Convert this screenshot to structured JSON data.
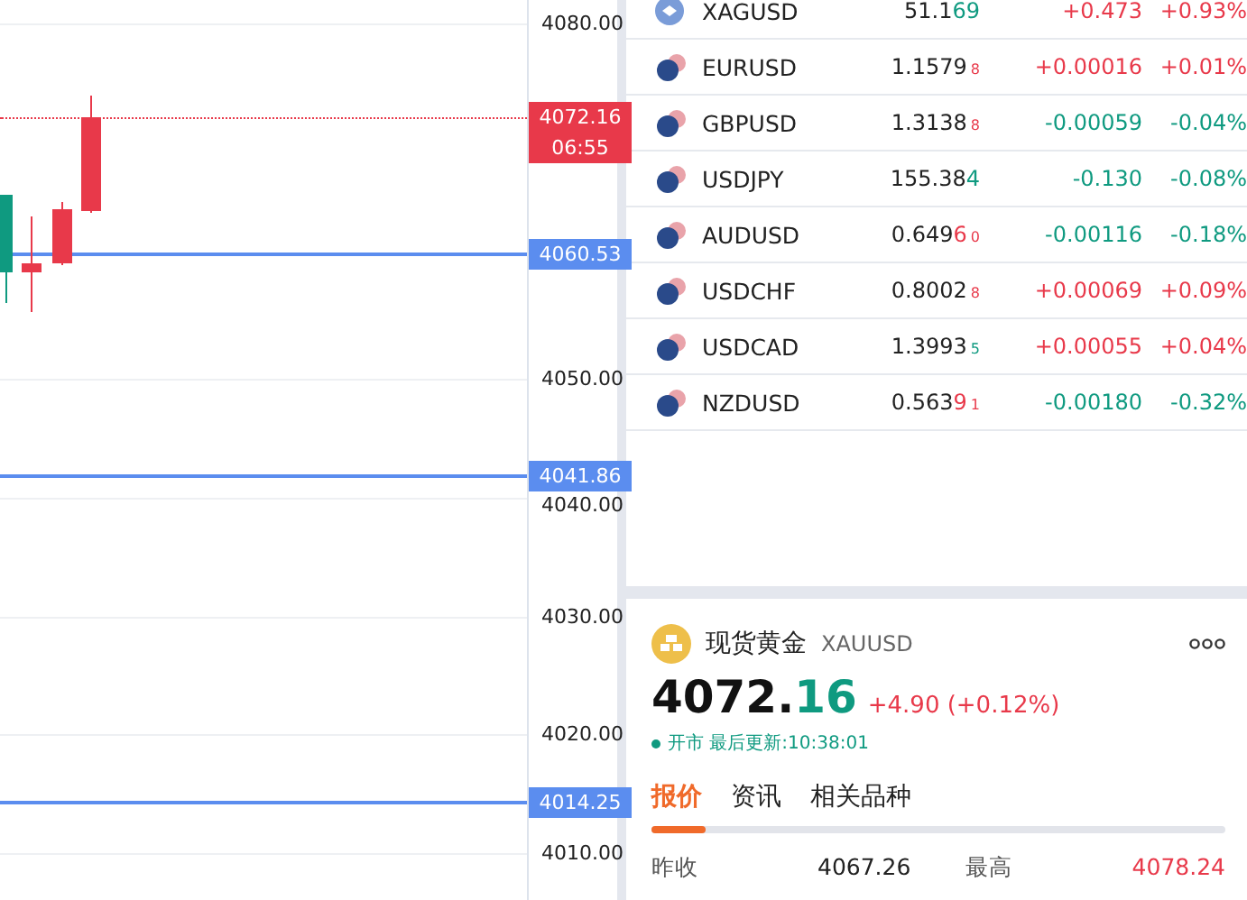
{
  "chart": {
    "axis_labels": [
      "4080.00",
      "4050.00",
      "4040.00",
      "4030.00",
      "4020.00",
      "4010.00"
    ],
    "price_lines": [
      "4060.53",
      "4041.86",
      "4014.25"
    ],
    "last_price": {
      "price": "4072.16",
      "countdown": "06:55"
    }
  },
  "watchlist": [
    {
      "kind": "metal",
      "symbol": "XAGUSD",
      "price_main": "51.1",
      "price_tick": "69",
      "price_up": false,
      "change": "+0.473",
      "percent": "+0.93%",
      "up": true
    },
    {
      "kind": "pair",
      "symbol": "EURUSD",
      "price_main": "1.1579",
      "price_pip": "8",
      "price_up": true,
      "change": "+0.00016",
      "percent": "+0.01%",
      "up": true
    },
    {
      "kind": "pair",
      "symbol": "GBPUSD",
      "price_main": "1.3138",
      "price_pip": "8",
      "price_up": true,
      "change": "-0.00059",
      "percent": "-0.04%",
      "up": false
    },
    {
      "kind": "pair",
      "symbol": "USDJPY",
      "price_main": "155.38",
      "price_tick": "4",
      "price_up": false,
      "change": "-0.130",
      "percent": "-0.08%",
      "up": false
    },
    {
      "kind": "pair",
      "symbol": "AUDUSD",
      "price_main": "0.649",
      "price_tick": "6",
      "price_pip": "0",
      "price_up": true,
      "change": "-0.00116",
      "percent": "-0.18%",
      "up": false
    },
    {
      "kind": "pair",
      "symbol": "USDCHF",
      "price_main": "0.8002",
      "price_pip": "8",
      "price_up": true,
      "change": "+0.00069",
      "percent": "+0.09%",
      "up": true
    },
    {
      "kind": "pair",
      "symbol": "USDCAD",
      "price_main": "1.3993",
      "price_pip": "5",
      "price_up": false,
      "change": "+0.00055",
      "percent": "+0.04%",
      "up": true
    },
    {
      "kind": "pair",
      "symbol": "NZDUSD",
      "price_main": "0.563",
      "price_tick": "9",
      "price_pip": "1",
      "price_up": true,
      "change": "-0.00180",
      "percent": "-0.32%",
      "up": false
    }
  ],
  "detail": {
    "name": "现货黄金",
    "symbol": "XAUUSD",
    "price_main": "4072.",
    "price_tick": "16",
    "price_up": false,
    "change": "+4.90 (+0.12%)",
    "up": true,
    "status": "开市 最后更新:10:38:01",
    "tabs": [
      {
        "label": "报价",
        "selected": true
      },
      {
        "label": "资讯",
        "selected": false
      },
      {
        "label": "相关品种",
        "selected": false
      }
    ],
    "stats": [
      {
        "label": "昨收",
        "value": "4067.26",
        "highlighted": false
      },
      {
        "label": "最高",
        "value": "4078.24",
        "highlighted": true
      }
    ]
  }
}
